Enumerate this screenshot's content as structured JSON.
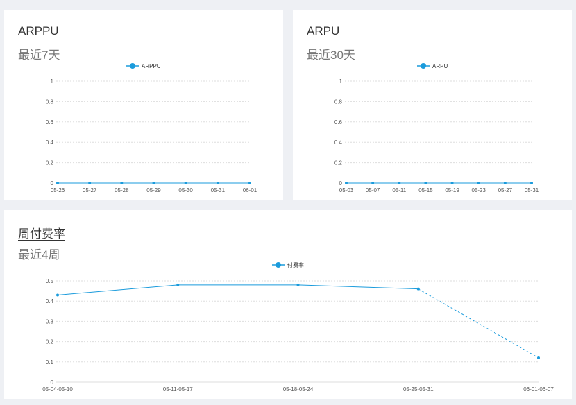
{
  "colors": {
    "series": "#1a9bdc",
    "grid": "#dddddd",
    "background": "#eef0f4"
  },
  "cards": [
    {
      "title": "ARPPU",
      "subtitle": "最近7天"
    },
    {
      "title": "ARPU",
      "subtitle": "最近30天"
    },
    {
      "title": "周付费率",
      "subtitle": "最近4周"
    }
  ],
  "chart_data": [
    {
      "type": "line",
      "title": "ARPPU",
      "subtitle": "最近7天",
      "categories": [
        "05-26",
        "05-27",
        "05-28",
        "05-29",
        "05-30",
        "05-31",
        "06-01"
      ],
      "series": [
        {
          "name": "ARPPU",
          "values": [
            0,
            0,
            0,
            0,
            0,
            0,
            0
          ]
        }
      ],
      "y_ticks": [
        "0",
        "0.2",
        "0.4",
        "0.6",
        "0.8",
        "1"
      ],
      "ylim": [
        0,
        1
      ],
      "grid": "horizontal dotted",
      "legend": "top-center"
    },
    {
      "type": "line",
      "title": "ARPU",
      "subtitle": "最近30天",
      "categories": [
        "05-03",
        "05-07",
        "05-11",
        "05-15",
        "05-19",
        "05-23",
        "05-27",
        "05-31"
      ],
      "series": [
        {
          "name": "ARPU",
          "values": [
            0,
            0,
            0,
            0,
            0,
            0,
            0,
            0
          ]
        }
      ],
      "y_ticks": [
        "0",
        "0.2",
        "0.4",
        "0.6",
        "0.8",
        "1"
      ],
      "ylim": [
        0,
        1
      ],
      "grid": "horizontal dotted",
      "legend": "top-center"
    },
    {
      "type": "line",
      "title": "周付费率",
      "subtitle": "最近4周",
      "categories": [
        "05-04-05-10",
        "05-11-05-17",
        "05-18-05-24",
        "05-25-05-31",
        "06-01-06-07"
      ],
      "series": [
        {
          "name": "付费率",
          "values": [
            0.43,
            0.48,
            0.48,
            0.46,
            0.12
          ],
          "dashed_last_segment": true
        }
      ],
      "y_ticks": [
        "0",
        "0.1",
        "0.2",
        "0.3",
        "0.4",
        "0.5"
      ],
      "ylim": [
        0,
        0.5
      ],
      "grid": "horizontal dotted",
      "legend": "top-center"
    }
  ]
}
